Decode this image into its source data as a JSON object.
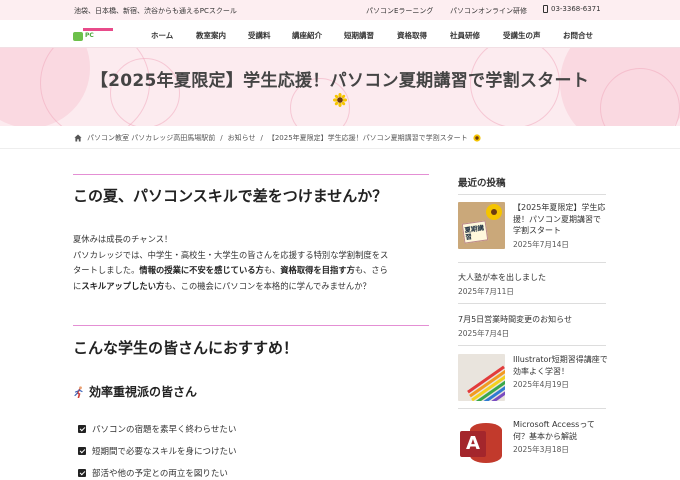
{
  "topbar": {
    "tagline": "池袋、日本橋、新宿、渋谷からも通えるPCスクール",
    "link1": "パソコンEラーニング",
    "link2": "パソコンオンライン研修",
    "phone": "03-3368-6371"
  },
  "logo": {
    "text": "PC"
  },
  "nav": [
    "ホーム",
    "教室案内",
    "受講料",
    "講座紹介",
    "短期講習",
    "資格取得",
    "社員研修",
    "受講生の声",
    "お問合せ"
  ],
  "hero": {
    "title": "【2025年夏限定】学生応援！パソコン夏期講習で学割スタート"
  },
  "breadcrumb": {
    "home": "パソコン教室 パソカレッジ高田馬場駅前",
    "sep": "/",
    "category": "お知らせ",
    "current": "【2025年夏限定】学生応援！パソコン夏期講習で学割スタート"
  },
  "article": {
    "heading1": "この夏、パソコンスキルで差をつけませんか？",
    "p_line1": "夏休みは成長のチャンス！",
    "p_line2": "パソカレッジでは、中学生・高校生・大学生の皆さんを応援する特別な学割制度をス",
    "p_line3": "タートしました。",
    "p_b1": "情報の授業に不安を感じている方",
    "p_t1": "も、",
    "p_b2": "資格取得を目指す方",
    "p_t2": "も、さら",
    "p_t3": "に",
    "p_b3": "スキルアップしたい方",
    "p_t4": "も、この機会にパソコンを本格的に学んでみませんか？",
    "heading2": "こんな学生の皆さんにおすすめ！",
    "heading3": "効率重視派の皆さん",
    "checks": [
      "パソコンの宿題を素早く終わらせたい",
      "短期間で必要なスキルを身につけたい",
      "部活や他の予定との両立を図りたい"
    ]
  },
  "sidebar": {
    "title": "最近の投稿",
    "posts": [
      {
        "title": "【2025年夏限定】学生応援！パソコン夏期講習で学割スタート",
        "date": "2025年7月14日",
        "thumb_text": "夏期講習"
      },
      {
        "title": "大人塾が本を出しました",
        "date": "2025年7月11日"
      },
      {
        "title": "7月5日営業時間変更のお知らせ",
        "date": "2025年7月4日"
      },
      {
        "title": "Illustrator短期習得講座で効率よく学習！",
        "date": "2025年4月19日"
      },
      {
        "title": "Microsoft Accessって何？基本から解説",
        "date": "2025年3月18日",
        "thumb_text": "A"
      }
    ]
  },
  "colors": {
    "accent_pink": "#e48fd4",
    "hero_bg": "#fcebef",
    "topbar_bg": "#fdeef1"
  }
}
